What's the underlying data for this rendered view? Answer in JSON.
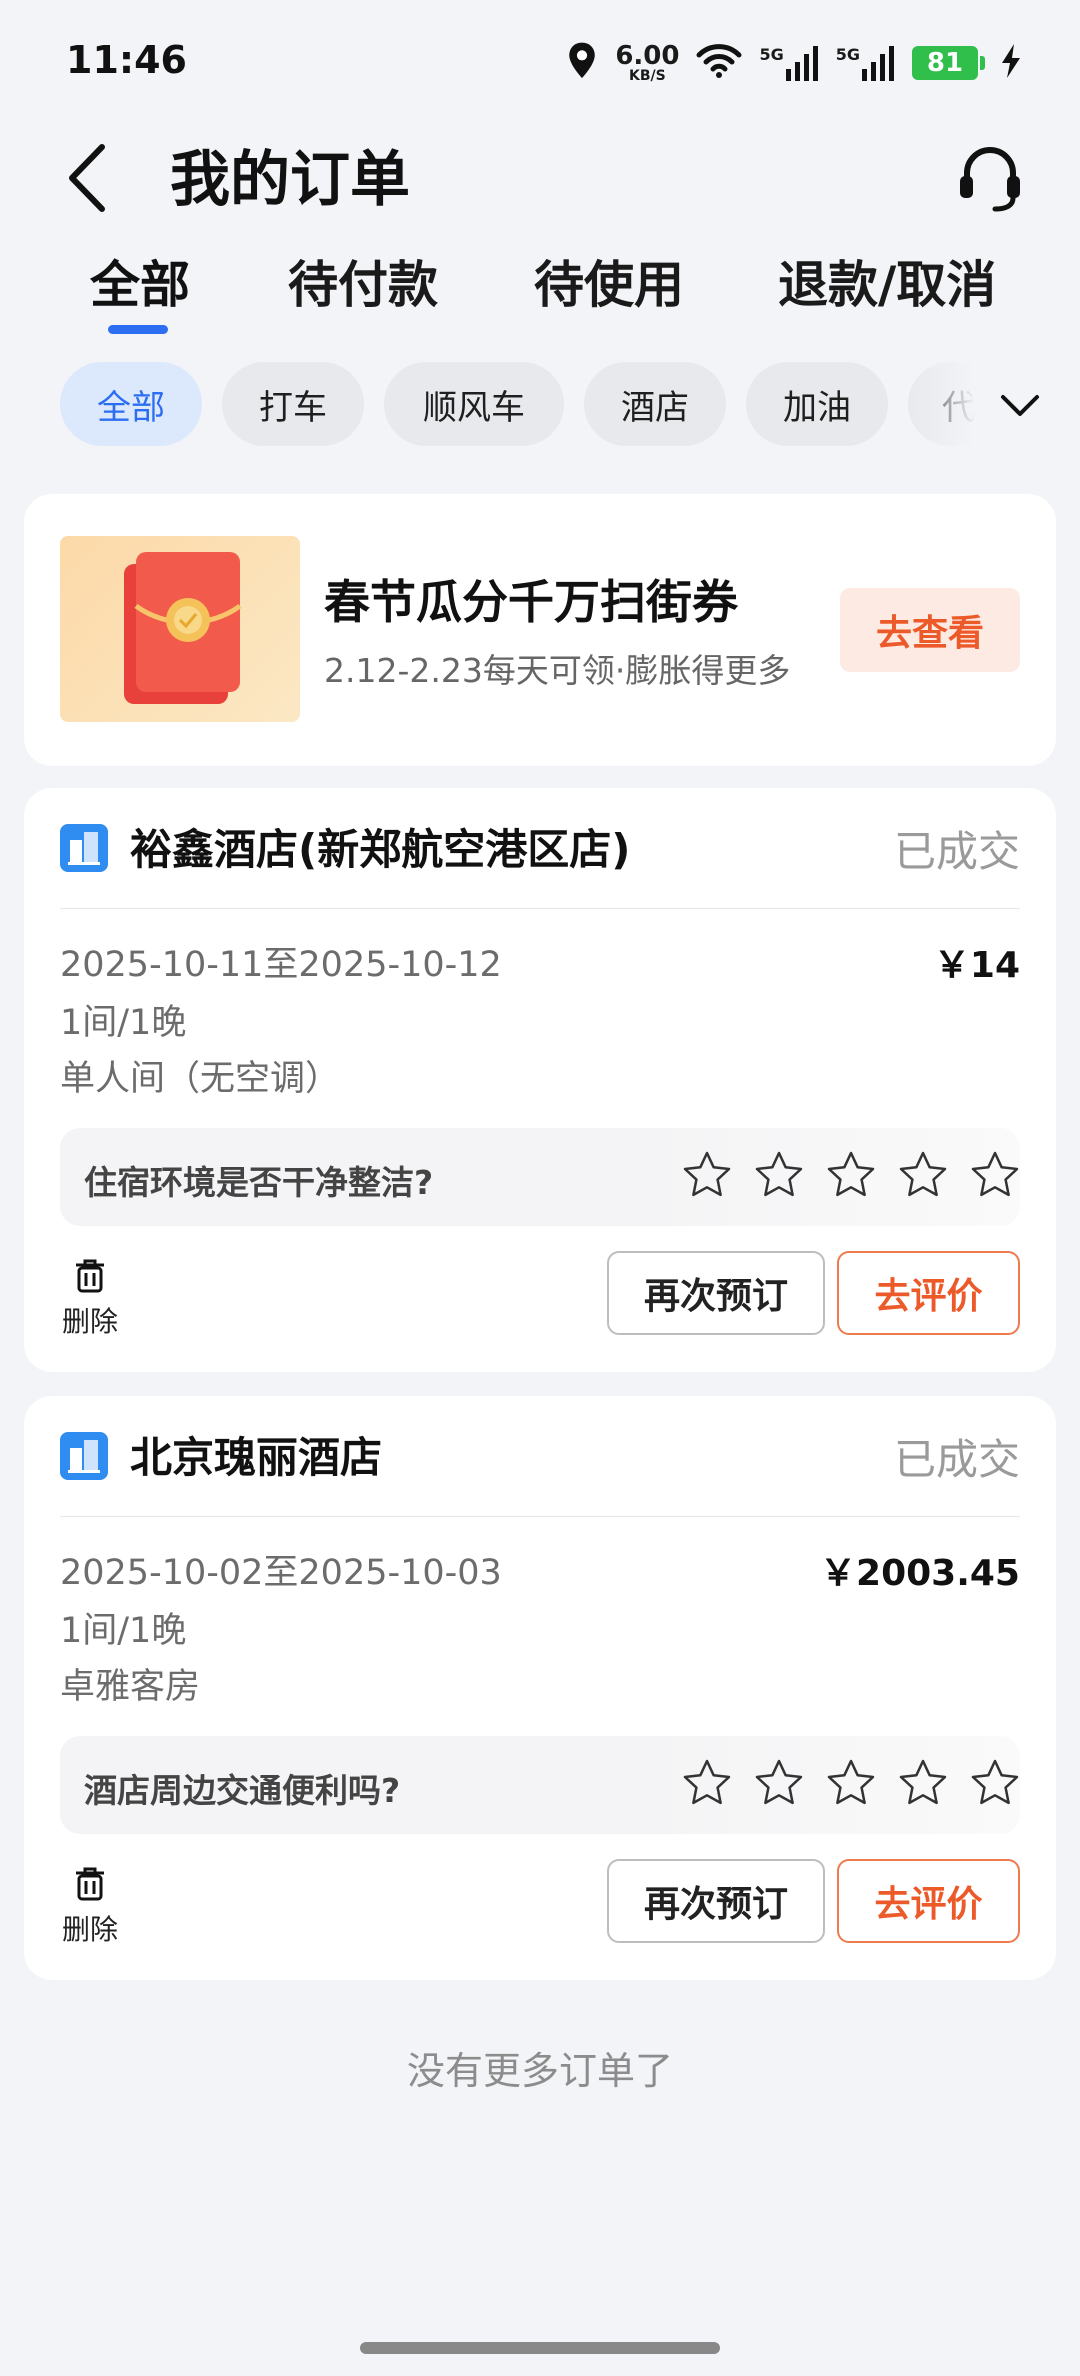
{
  "status_bar": {
    "time": "11:46",
    "net_speed_value": "6.00",
    "net_speed_unit": "KB/S",
    "signal_label_1": "5G",
    "signal_label_2": "5G",
    "battery": "81",
    "icons": [
      "location-icon",
      "wifi-icon",
      "signal-5g-icon",
      "signal-5g-icon",
      "battery-icon",
      "charging-icon"
    ]
  },
  "header": {
    "title": "我的订单",
    "back_icon": "back-arrow-icon",
    "service_icon": "headset-icon"
  },
  "main_tabs": [
    {
      "label": "全部",
      "active": true
    },
    {
      "label": "待付款",
      "active": false
    },
    {
      "label": "待使用",
      "active": false
    },
    {
      "label": "退款/取消",
      "active": false
    }
  ],
  "categories": [
    {
      "label": "全部",
      "active": true
    },
    {
      "label": "打车",
      "active": false
    },
    {
      "label": "顺风车",
      "active": false
    },
    {
      "label": "酒店",
      "active": false
    },
    {
      "label": "加油",
      "active": false
    },
    {
      "label": "代",
      "active": false
    }
  ],
  "promo": {
    "title": "春节瓜分千万扫街券",
    "subtitle": "2.12-2.23每天可领·膨胀得更多",
    "button": "去查看",
    "image_icon": "red-envelope-icon"
  },
  "orders": [
    {
      "hotel": "裕鑫酒店(新郑航空港区店)",
      "status": "已成交",
      "dates": "2025-10-11至2025-10-12",
      "price": "￥14",
      "rooms": "1间/1晚",
      "room_type": "单人间（无空调）",
      "question": "住宿环境是否干净整洁?",
      "stars": 0,
      "delete": "删除",
      "rebook": "再次预订",
      "review": "去评价"
    },
    {
      "hotel": "北京瑰丽酒店",
      "status": "已成交",
      "dates": "2025-10-02至2025-10-03",
      "price": "￥2003.45",
      "rooms": "1间/1晚",
      "room_type": "卓雅客房",
      "question": "酒店周边交通便利吗?",
      "stars": 0,
      "delete": "删除",
      "rebook": "再次预订",
      "review": "去评价"
    }
  ],
  "footer": {
    "no_more": "没有更多订单了"
  },
  "colors": {
    "accent_blue": "#2b6ef2",
    "accent_orange": "#ed5a2a",
    "battery_green": "#2fbf4a",
    "background": "#f3f4f7"
  }
}
